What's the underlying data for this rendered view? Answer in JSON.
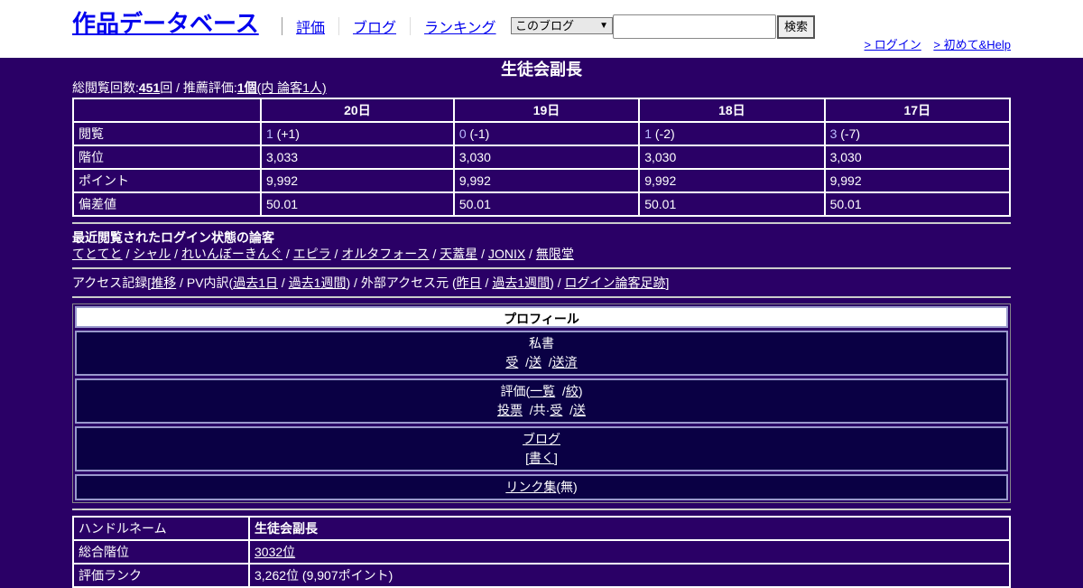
{
  "header": {
    "site_title": "作品データベース",
    "nav": [
      "評価",
      "ブログ",
      "ランキング"
    ],
    "select_value": "このブログ",
    "search_button": "検索",
    "login_link": "> ログイン",
    "help_link": "> 初めて&Help"
  },
  "page": {
    "title": "生徒会副長",
    "summary_prefix": "総閲覧回数:",
    "total_views": "451",
    "summary_mid": "回 / 推薦評価:",
    "recommend_count": "1個",
    "recommend_detail": "(内 論客1人)"
  },
  "stats": {
    "headers": [
      "",
      "20日",
      "19日",
      "18日",
      "17日"
    ],
    "rows": [
      {
        "label": "閲覧",
        "cells": [
          {
            "a": "1",
            "b": " (+1)"
          },
          {
            "a": "0",
            "b": " (-1)"
          },
          {
            "a": "1",
            "b": " (-2)"
          },
          {
            "a": "3",
            "b": " (-7)"
          }
        ]
      },
      {
        "label": "階位",
        "cells": [
          {
            "a": "3,033",
            "b": ""
          },
          {
            "a": "3,030",
            "b": ""
          },
          {
            "a": "3,030",
            "b": ""
          },
          {
            "a": "3,030",
            "b": ""
          }
        ]
      },
      {
        "label": "ポイント",
        "cells": [
          {
            "a": "9,992",
            "b": ""
          },
          {
            "a": "9,992",
            "b": ""
          },
          {
            "a": "9,992",
            "b": ""
          },
          {
            "a": "9,992",
            "b": ""
          }
        ]
      },
      {
        "label": "偏差値",
        "cells": [
          {
            "a": "50.01",
            "b": ""
          },
          {
            "a": "50.01",
            "b": ""
          },
          {
            "a": "50.01",
            "b": ""
          },
          {
            "a": "50.01",
            "b": ""
          }
        ]
      }
    ]
  },
  "recent": {
    "title": "最近閲覧されたログイン状態の論客",
    "users": [
      "てとてと",
      "シャル",
      "れいんぼーきんぐ",
      "エピラ",
      "オルタフォース",
      "天蓋星",
      "JONIX",
      "無限堂"
    ]
  },
  "access": {
    "t1": "アクセス記録[",
    "l1": "推移",
    "t2": " / PV内訳(",
    "l2": "過去1日",
    "t3": " / ",
    "l3": "過去1週間",
    "t4": ") / 外部アクセス元 (",
    "l4": "昨日",
    "t5": " / ",
    "l5": "過去1週間",
    "t6": ") / ",
    "l6": "ログイン論客足跡",
    "t7": "]"
  },
  "profile": {
    "heading": "プロフィール",
    "secretary": {
      "title": "私書",
      "links": [
        "受",
        "送",
        "送済"
      ]
    },
    "rating": {
      "title": "評価(",
      "list": "一覧",
      "filter": "絞",
      "vote": "投票",
      "shared": "共",
      "recv": "受",
      "send": "送"
    },
    "blog": {
      "title": "ブログ",
      "write": "書く"
    },
    "links": {
      "title": "リンク集",
      "state": "(無)"
    }
  },
  "info": {
    "rows": [
      {
        "label": "ハンドルネーム",
        "value": "生徒会副長"
      },
      {
        "label": "総合階位",
        "value": "3032位"
      },
      {
        "label": "評価ランク",
        "value": "3,262位 (9,907ポイント)"
      }
    ]
  }
}
